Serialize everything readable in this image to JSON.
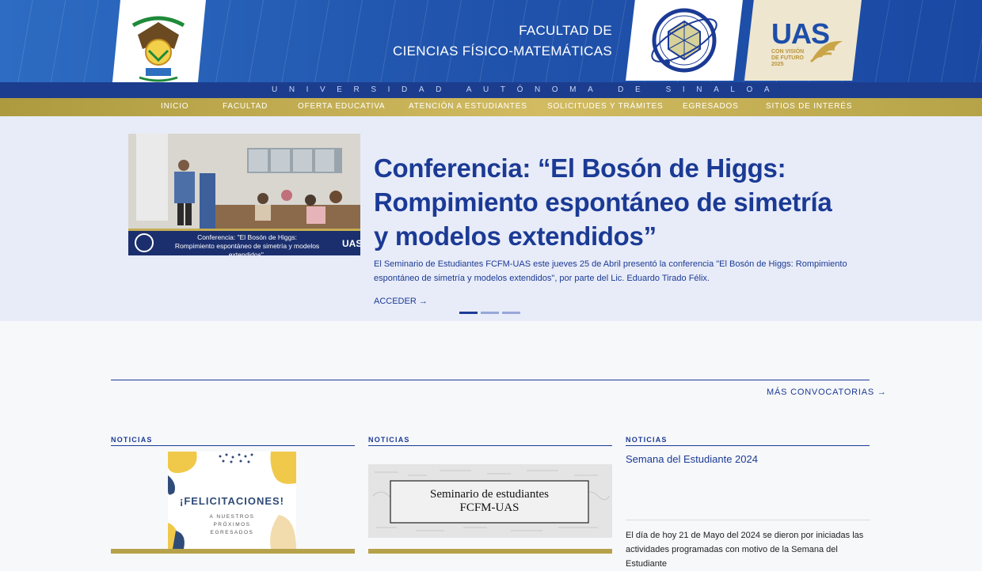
{
  "header": {
    "faculty_line1": "FACULTAD DE",
    "faculty_line2": "CIENCIAS FÍSICO-MATEMÁTICAS",
    "university": "UNIVERSIDAD AUTÓNOMA DE SINALOA",
    "uas_logo": "UAS",
    "uas_slogan": "CON VISIÓN DE FUTURO 2025"
  },
  "nav": {
    "items": [
      "INICIO",
      "FACULTAD",
      "OFERTA EDUCATIVA",
      "ATENCIÓN A ESTUDIANTES",
      "SOLICITUDES Y TRÁMITES",
      "EGRESADOS",
      "SITIOS DE INTERÉS"
    ]
  },
  "hero": {
    "image_caption_line1": "Conferencia: \"El Bosón de Higgs:",
    "image_caption_line2": "Rompimiento espontáneo de simetría y modelos extendidos\".",
    "title": "Conferencia: “El Bosón de Higgs: Rompimiento espontáneo de simetría y modelos extendidos”",
    "description": "El Seminario de Estudiantes FCFM-UAS este jueves 25 de Abril presentó la conferencia \"El Bosón de Higgs: Rompimiento espontáneo de simetría y modelos extendidos\", por parte del Lic. Eduardo Tirado Félix.",
    "link": "ACCEDER →"
  },
  "section": {
    "more_link": "MÁS CONVOCATORIAS →"
  },
  "cards": [
    {
      "category": "NOTICIAS",
      "image_title": "¡FELICITACIONES!",
      "image_subtitle": "A NUESTROS PRÓXIMOS EGRESADOS"
    },
    {
      "category": "NOTICIAS",
      "image_title_1": "Seminario de estudiantes",
      "image_title_2": "FCFM-UAS"
    },
    {
      "category": "NOTICIAS",
      "title": "Semana del Estudiante 2024",
      "text": "El día de hoy 21 de Mayo del 2024 se dieron por iniciadas las actividades programadas con motivo de la Semana del Estudiante"
    }
  ],
  "colors": {
    "primary": "#1b3a95",
    "gold": "#c4ad52",
    "hero_bg": "#e8ecf8"
  }
}
